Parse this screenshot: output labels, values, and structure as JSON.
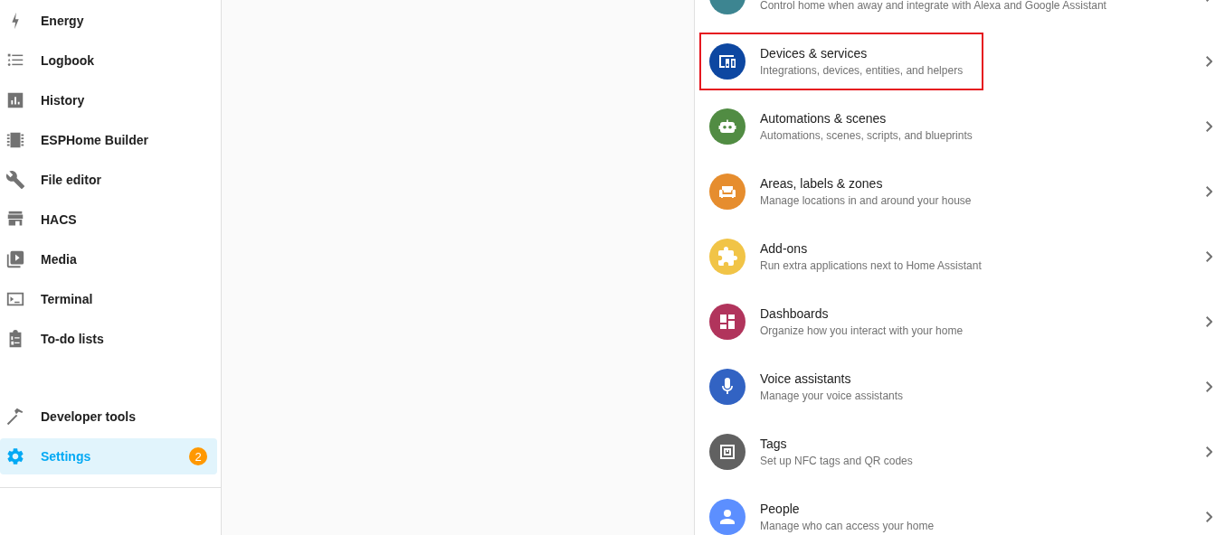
{
  "sidebar": {
    "items": [
      {
        "label": "Energy",
        "selected": false
      },
      {
        "label": "Logbook",
        "selected": false
      },
      {
        "label": "History",
        "selected": false
      },
      {
        "label": "ESPHome Builder",
        "selected": false
      },
      {
        "label": "File editor",
        "selected": false
      },
      {
        "label": "HACS",
        "selected": false
      },
      {
        "label": "Media",
        "selected": false
      },
      {
        "label": "Terminal",
        "selected": false
      },
      {
        "label": "To-do lists",
        "selected": false
      }
    ],
    "footer_items": [
      {
        "label": "Developer tools",
        "selected": false
      },
      {
        "label": "Settings",
        "selected": true,
        "badge": "2"
      }
    ]
  },
  "settings": {
    "items": [
      {
        "description": "Control home when away and integrate with Alexa and Google Assistant",
        "color": "#3d8591",
        "highlighted": false
      },
      {
        "title": "Devices & services",
        "description": "Integrations, devices, entities, and helpers",
        "color": "#0d47a1",
        "highlighted": true
      },
      {
        "title": "Automations & scenes",
        "description": "Automations, scenes, scripts, and blueprints",
        "color": "#518c43",
        "highlighted": false
      },
      {
        "title": "Areas, labels & zones",
        "description": "Manage locations in and around your house",
        "color": "#e68d2e",
        "highlighted": false
      },
      {
        "title": "Add-ons",
        "description": "Run extra applications next to Home Assistant",
        "color": "#f1c447",
        "highlighted": false
      },
      {
        "title": "Dashboards",
        "description": "Organize how you interact with your home",
        "color": "#b1345c",
        "highlighted": false
      },
      {
        "title": "Voice assistants",
        "description": "Manage your voice assistants",
        "color": "#3263c3",
        "highlighted": false
      },
      {
        "title": "Tags",
        "description": "Set up NFC tags and QR codes",
        "color": "#616161",
        "highlighted": false
      },
      {
        "title": "People",
        "description": "Manage who can access your home",
        "color": "#5c8fff",
        "highlighted": false
      }
    ]
  }
}
